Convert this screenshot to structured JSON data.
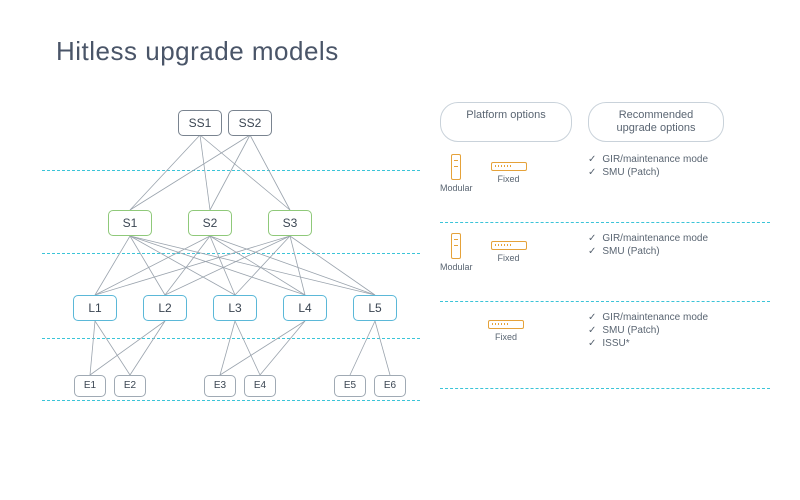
{
  "title": "Hitless upgrade models",
  "headers": {
    "platform": "Platform options",
    "upgrade": "Recommended\nupgrade options"
  },
  "pm_labels": {
    "modular": "Modular",
    "fixed": "Fixed"
  },
  "tiers": {
    "super_spine": {
      "nodes": [
        "SS1",
        "SS2"
      ]
    },
    "spine": {
      "nodes": [
        "S1",
        "S2",
        "S3"
      ]
    },
    "leaf": {
      "nodes": [
        "L1",
        "L2",
        "L3",
        "L4",
        "L5"
      ]
    },
    "endpoint": {
      "nodes": [
        "E1",
        "E2",
        "E3",
        "E4",
        "E5",
        "E6"
      ]
    }
  },
  "legend_rows": [
    {
      "has_modular": true,
      "has_fixed": true,
      "options": [
        "GIR/maintenance mode",
        "SMU (Patch)"
      ]
    },
    {
      "has_modular": true,
      "has_fixed": true,
      "options": [
        "GIR/maintenance mode",
        "SMU (Patch)"
      ]
    },
    {
      "has_modular": false,
      "has_fixed": true,
      "options": [
        "GIR/maintenance mode",
        "SMU (Patch)",
        "ISSU*"
      ]
    }
  ]
}
